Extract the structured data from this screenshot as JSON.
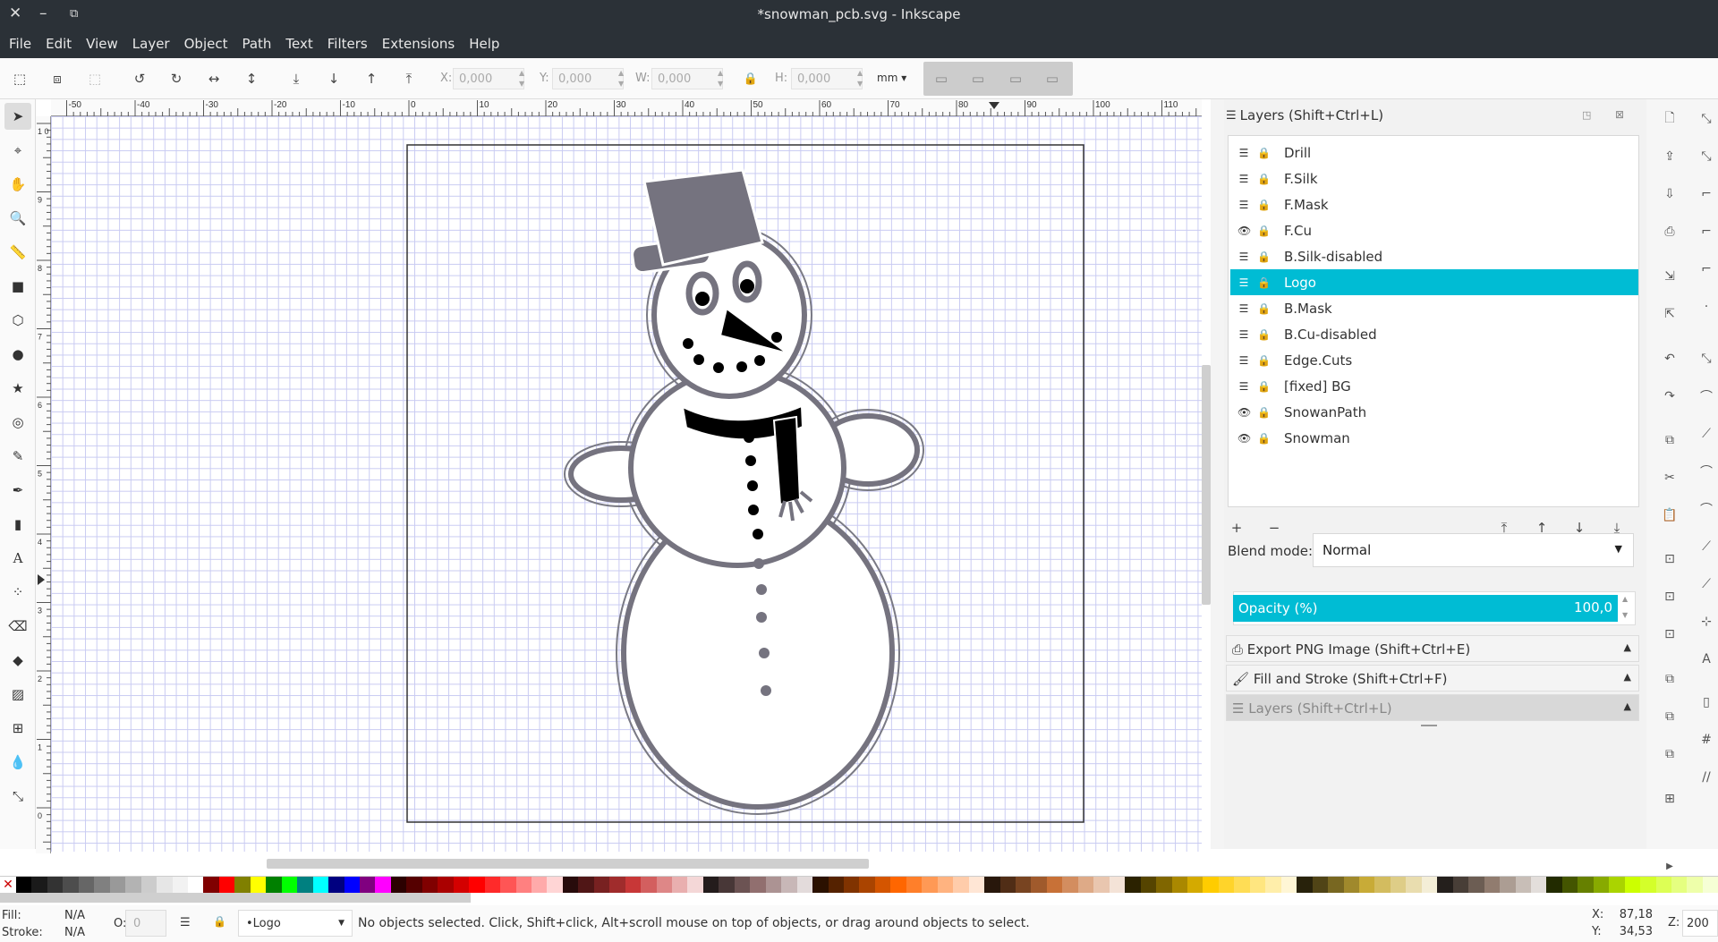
{
  "window": {
    "title": "*snowman_pcb.svg - Inkscape"
  },
  "menu": [
    "File",
    "Edit",
    "View",
    "Layer",
    "Object",
    "Path",
    "Text",
    "Filters",
    "Extensions",
    "Help"
  ],
  "toolbar": {
    "x_label": "X:",
    "x_value": "0,000",
    "y_label": "Y:",
    "y_value": "0,000",
    "w_label": "W:",
    "w_value": "0,000",
    "h_label": "H:",
    "h_value": "0,000",
    "unit": "mm"
  },
  "ruler": {
    "h_ticks": [
      "-50",
      "-40",
      "-30",
      "-20",
      "-10",
      "0",
      "10",
      "20",
      "30",
      "40",
      "50",
      "60",
      "70",
      "80",
      "90",
      "100",
      "110"
    ],
    "v_ticks": [
      "1\n0",
      "9",
      "8",
      "7",
      "6",
      "5",
      "4",
      "3",
      "2",
      "1",
      "0"
    ]
  },
  "layers_panel": {
    "title": "Layers (Shift+Ctrl+L)",
    "layers": [
      {
        "name": "Drill",
        "visible": false,
        "selected": false
      },
      {
        "name": "F.Silk",
        "visible": false,
        "selected": false
      },
      {
        "name": "F.Mask",
        "visible": false,
        "selected": false
      },
      {
        "name": "F.Cu",
        "visible": true,
        "selected": false
      },
      {
        "name": "B.Silk-disabled",
        "visible": false,
        "selected": false
      },
      {
        "name": "Logo",
        "visible": false,
        "selected": true
      },
      {
        "name": "B.Mask",
        "visible": false,
        "selected": false
      },
      {
        "name": "B.Cu-disabled",
        "visible": false,
        "selected": false
      },
      {
        "name": "Edge.Cuts",
        "visible": false,
        "selected": false
      },
      {
        "name": "[fixed] BG",
        "visible": false,
        "selected": false
      },
      {
        "name": "SnowanPath",
        "visible": true,
        "selected": false
      },
      {
        "name": "Snowman",
        "visible": true,
        "selected": false
      }
    ],
    "blend_label": "Blend mode:",
    "blend_value": "Normal",
    "opacity_label": "Opacity (%)",
    "opacity_value": "100,0"
  },
  "docks": [
    {
      "label": "Export PNG Image (Shift+Ctrl+E)",
      "icon": "export-icon"
    },
    {
      "label": "Fill and Stroke (Shift+Ctrl+F)",
      "icon": "brush-icon"
    },
    {
      "label": "Layers (Shift+Ctrl+L)",
      "icon": "layers-icon"
    }
  ],
  "status": {
    "fill_label": "Fill:",
    "fill_value": "N/A",
    "stroke_label": "Stroke:",
    "stroke_value": "N/A",
    "opacity_label": "O:",
    "opacity_value": "0",
    "layer": "•Logo",
    "message": "No objects selected. Click, Shift+click, Alt+scroll mouse on top of objects, or drag around objects to select.",
    "x_label": "X:",
    "x_value": "87,18",
    "y_label": "Y:",
    "y_value": "34,53",
    "z_label": "Z:",
    "zoom": "200"
  },
  "palette": [
    "#000000",
    "#1a1a1a",
    "#333333",
    "#4d4d4d",
    "#666666",
    "#808080",
    "#999999",
    "#b3b3b3",
    "#cccccc",
    "#e6e6e6",
    "#f2f2f2",
    "#ffffff",
    "#800000",
    "#ff0000",
    "#808000",
    "#ffff00",
    "#008000",
    "#00ff00",
    "#008080",
    "#00ffff",
    "#000080",
    "#0000ff",
    "#800080",
    "#ff00ff",
    "#2b0000",
    "#550000",
    "#800000",
    "#aa0000",
    "#d40000",
    "#ff0000",
    "#ff2a2a",
    "#ff5555",
    "#ff8080",
    "#ffaaaa",
    "#ffd5d5",
    "#280b0b",
    "#501616",
    "#782121",
    "#a02c2c",
    "#c83737",
    "#d35f5f",
    "#de8787",
    "#e9afaf",
    "#f4d7d7",
    "#241c1c",
    "#483737",
    "#6c5353",
    "#916f6f",
    "#ac9393",
    "#c8b7b7",
    "#e3dbdb",
    "#2b1100",
    "#552200",
    "#803300",
    "#aa4400",
    "#d45500",
    "#ff6600",
    "#ff7f2a",
    "#ff9955",
    "#ffb380",
    "#ffccaa",
    "#ffe6d5",
    "#28170b",
    "#502d16",
    "#784421",
    "#a05a2c",
    "#c87137",
    "#d38d5f",
    "#deaa87",
    "#e9c6af",
    "#f4e3d7",
    "#2b2200",
    "#554400",
    "#806600",
    "#aa8800",
    "#d4aa00",
    "#ffcc00",
    "#ffd42a",
    "#ffdd55",
    "#ffe680",
    "#ffeeaa",
    "#fff6d5",
    "#28220b",
    "#504416",
    "#786721",
    "#a0892c",
    "#c8ab37",
    "#d3bc5f",
    "#decd87",
    "#e9ddaf",
    "#f4eed7",
    "#241f1c",
    "#483e37",
    "#6c5d53",
    "#917c6f",
    "#ac9d93",
    "#c8beb7",
    "#e3dedb",
    "#222b00",
    "#445500",
    "#668000",
    "#88aa00",
    "#aad400",
    "#ccff00",
    "#d4ff2a",
    "#ddff55",
    "#e5ff80",
    "#eeffaa",
    "#f6ffd5"
  ]
}
